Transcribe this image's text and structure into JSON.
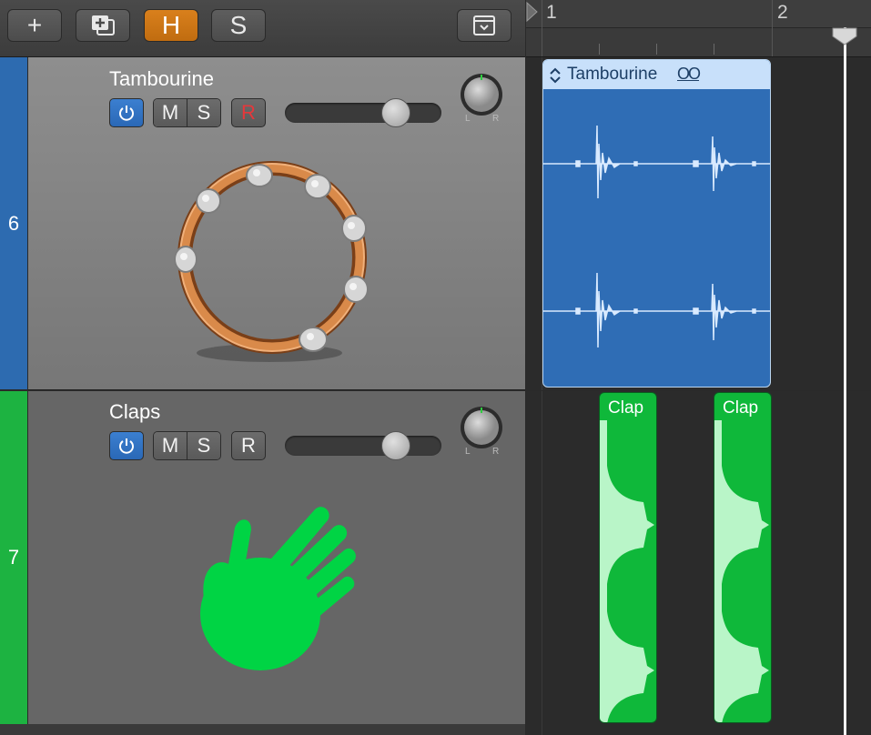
{
  "toolbar": {
    "add_label": "+",
    "h_label": "H",
    "s_label": "S"
  },
  "ruler": {
    "bars": [
      "1",
      "2"
    ]
  },
  "tracks": [
    {
      "number": "6",
      "name": "Tambourine",
      "color": "#2d6bb0",
      "mute": "M",
      "solo": "S",
      "record": "R",
      "record_color": "#e5383b",
      "pan_left": "L",
      "pan_right": "R",
      "volume_level": 0.78,
      "region": {
        "name": "Tambourine",
        "loop_icon": "OO"
      }
    },
    {
      "number": "7",
      "name": "Claps",
      "color": "#1db341",
      "mute": "M",
      "solo": "S",
      "record": "R",
      "record_color": "#f2f2f2",
      "pan_left": "L",
      "pan_right": "R",
      "volume_level": 0.78,
      "regions": [
        {
          "name": "Clap"
        },
        {
          "name": "Clap"
        }
      ]
    }
  ],
  "colors": {
    "accent_orange": "#d9801c",
    "track6_region": "#2f6db5",
    "track7_region": "#0fb83a"
  }
}
